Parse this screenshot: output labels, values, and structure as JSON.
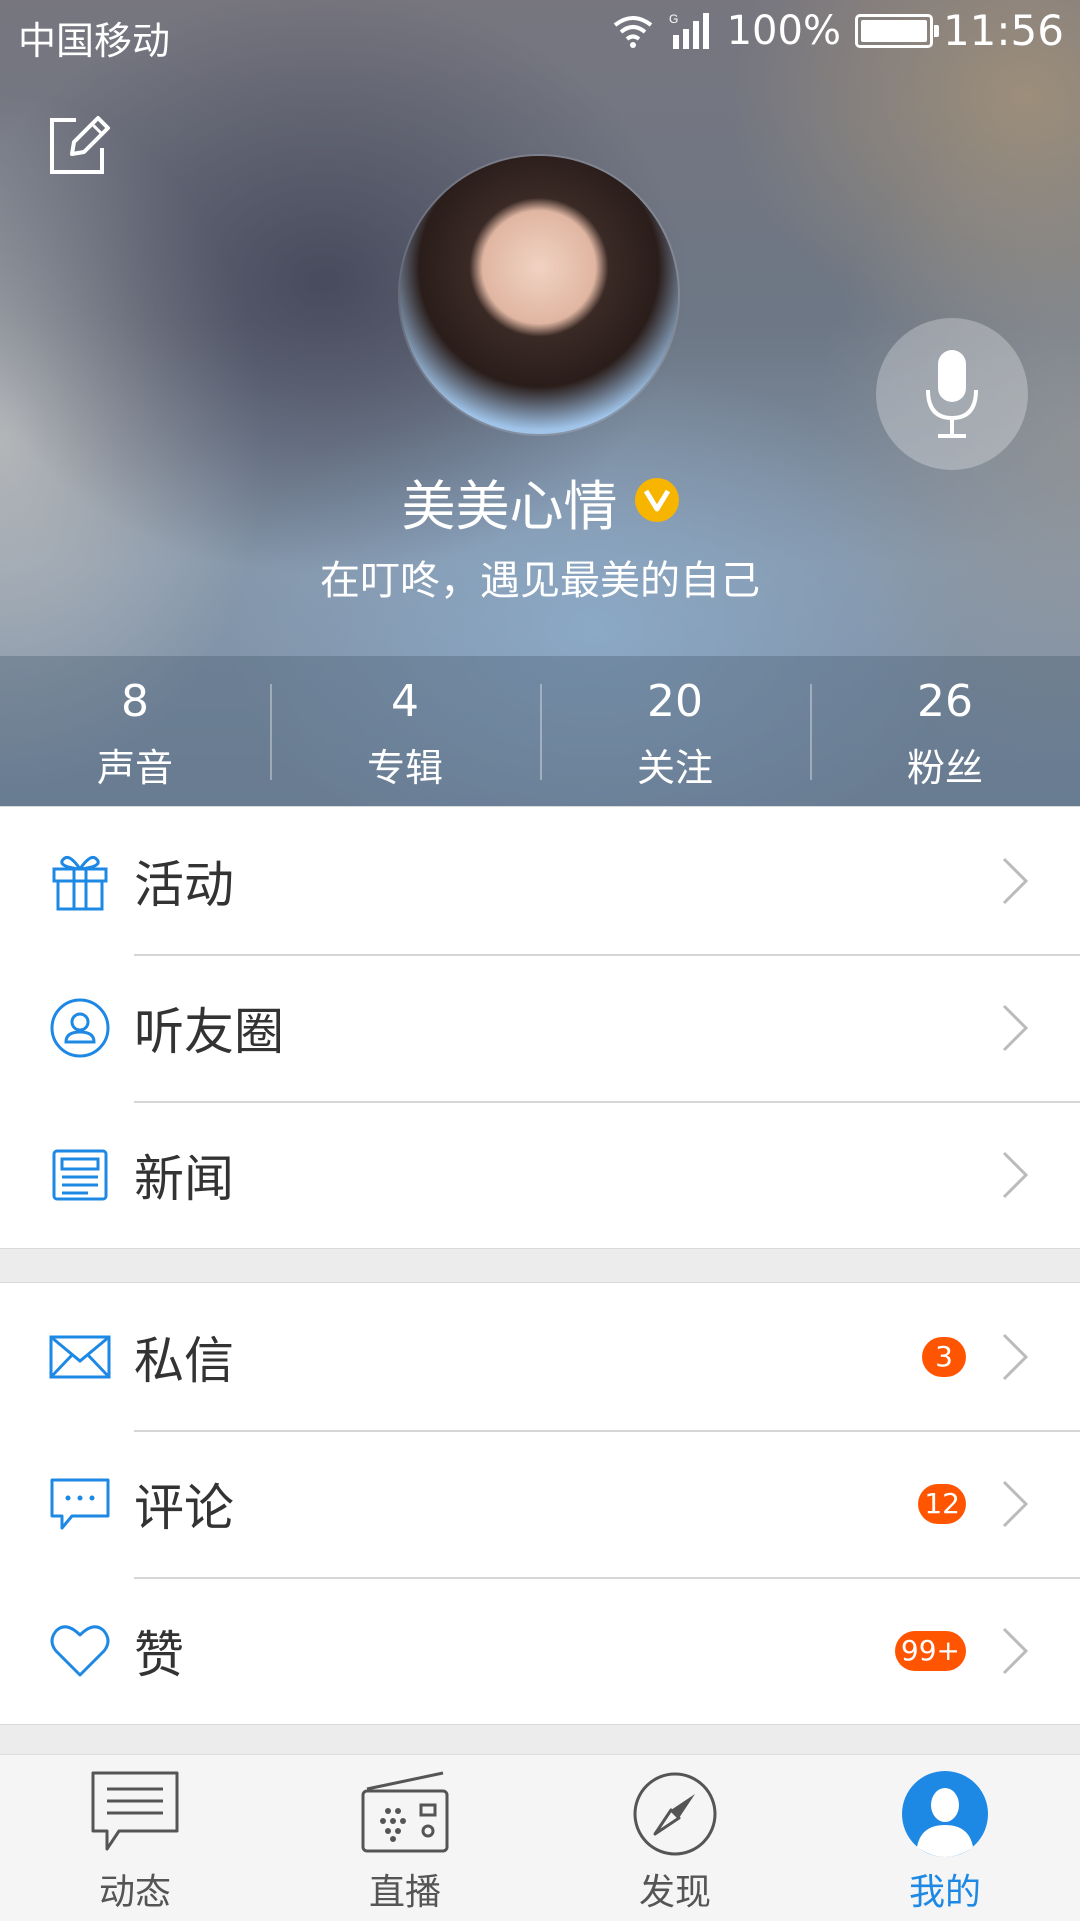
{
  "status_bar": {
    "carrier": "中国移动",
    "network": "G",
    "battery": "100%",
    "time": "11:56"
  },
  "profile": {
    "name": "美美心情",
    "bio": "在叮咚，遇见最美的自己",
    "stats": [
      {
        "value": "8",
        "label": "声音"
      },
      {
        "value": "4",
        "label": "专辑"
      },
      {
        "value": "20",
        "label": "关注"
      },
      {
        "value": "26",
        "label": "粉丝"
      }
    ]
  },
  "menu_group_1": [
    {
      "label": "活动",
      "icon": "gift-icon"
    },
    {
      "label": "听友圈",
      "icon": "friends-circle-icon"
    },
    {
      "label": "新闻",
      "icon": "news-icon"
    }
  ],
  "menu_group_2": [
    {
      "label": "私信",
      "icon": "mail-icon",
      "badge": "3"
    },
    {
      "label": "评论",
      "icon": "comment-icon",
      "badge": "12"
    },
    {
      "label": "赞",
      "icon": "heart-icon",
      "badge": "99+"
    }
  ],
  "tabs": [
    {
      "label": "动态",
      "icon": "chat-icon"
    },
    {
      "label": "直播",
      "icon": "radio-icon"
    },
    {
      "label": "发现",
      "icon": "compass-icon"
    },
    {
      "label": "我的",
      "icon": "user-icon",
      "active": true
    }
  ],
  "colors": {
    "accent": "#1e88e5",
    "badge": "#ff5500",
    "verified": "#f7b500"
  }
}
